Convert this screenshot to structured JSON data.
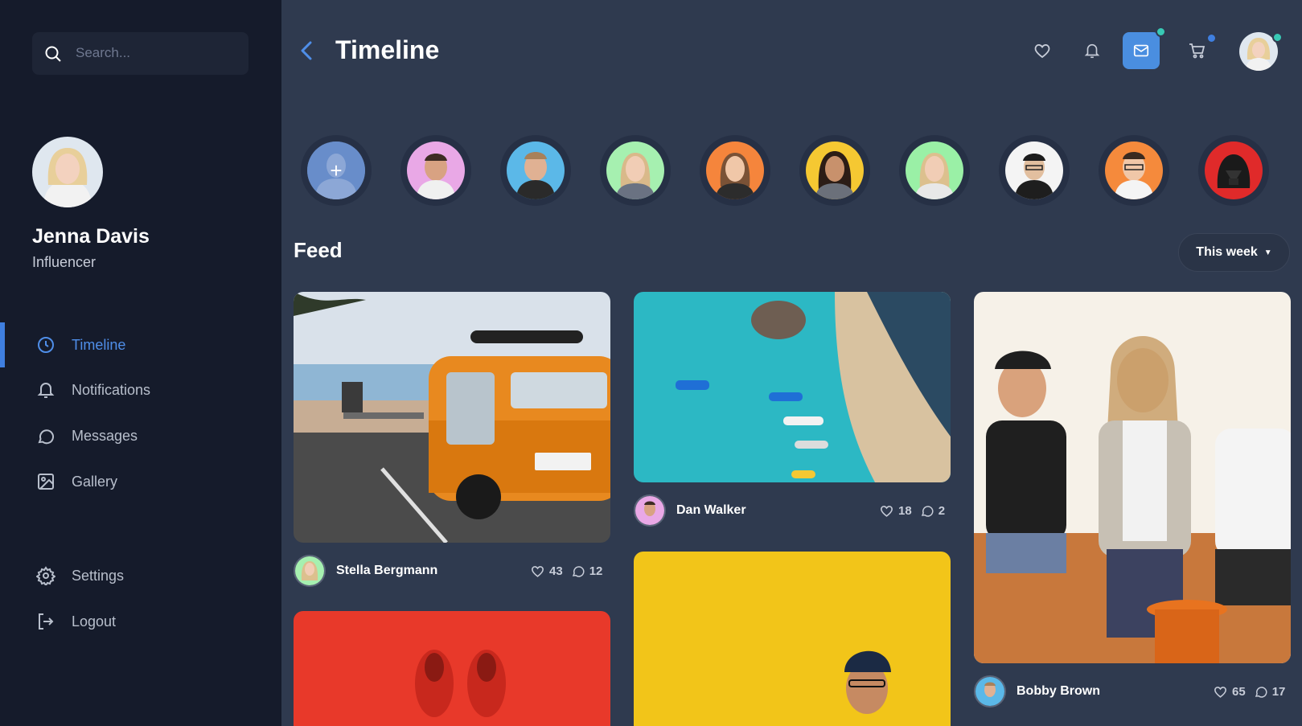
{
  "search": {
    "placeholder": "Search..."
  },
  "profile": {
    "name": "Jenna Davis",
    "role": "Influencer"
  },
  "nav": [
    {
      "label": "Timeline",
      "icon": "clock-icon",
      "active": true
    },
    {
      "label": "Notifications",
      "icon": "bell-icon"
    },
    {
      "label": "Messages",
      "icon": "chat-bubble-icon"
    },
    {
      "label": "Gallery",
      "icon": "image-icon"
    }
  ],
  "nav_bottom": [
    {
      "label": "Settings",
      "icon": "gear-icon"
    },
    {
      "label": "Logout",
      "icon": "logout-icon"
    }
  ],
  "header": {
    "title": "Timeline",
    "icons": [
      "heart-icon",
      "bell-icon",
      "mail-icon",
      "cart-icon"
    ]
  },
  "feed": {
    "title": "Feed",
    "filter_label": "This week",
    "posts": [
      {
        "author": "Stella Bergmann",
        "likes": "43",
        "comments": "12"
      },
      {
        "author": "Dan Walker",
        "likes": "18",
        "comments": "2"
      },
      {
        "author": "Bobby Brown",
        "likes": "65",
        "comments": "17"
      }
    ]
  },
  "colors": {
    "sidebar_bg": "#151b2b",
    "main_bg": "#2f3a4f",
    "accent": "#4f8ee8",
    "mail_button": "#4a8ee0",
    "online_dot": "#38c9b5"
  }
}
